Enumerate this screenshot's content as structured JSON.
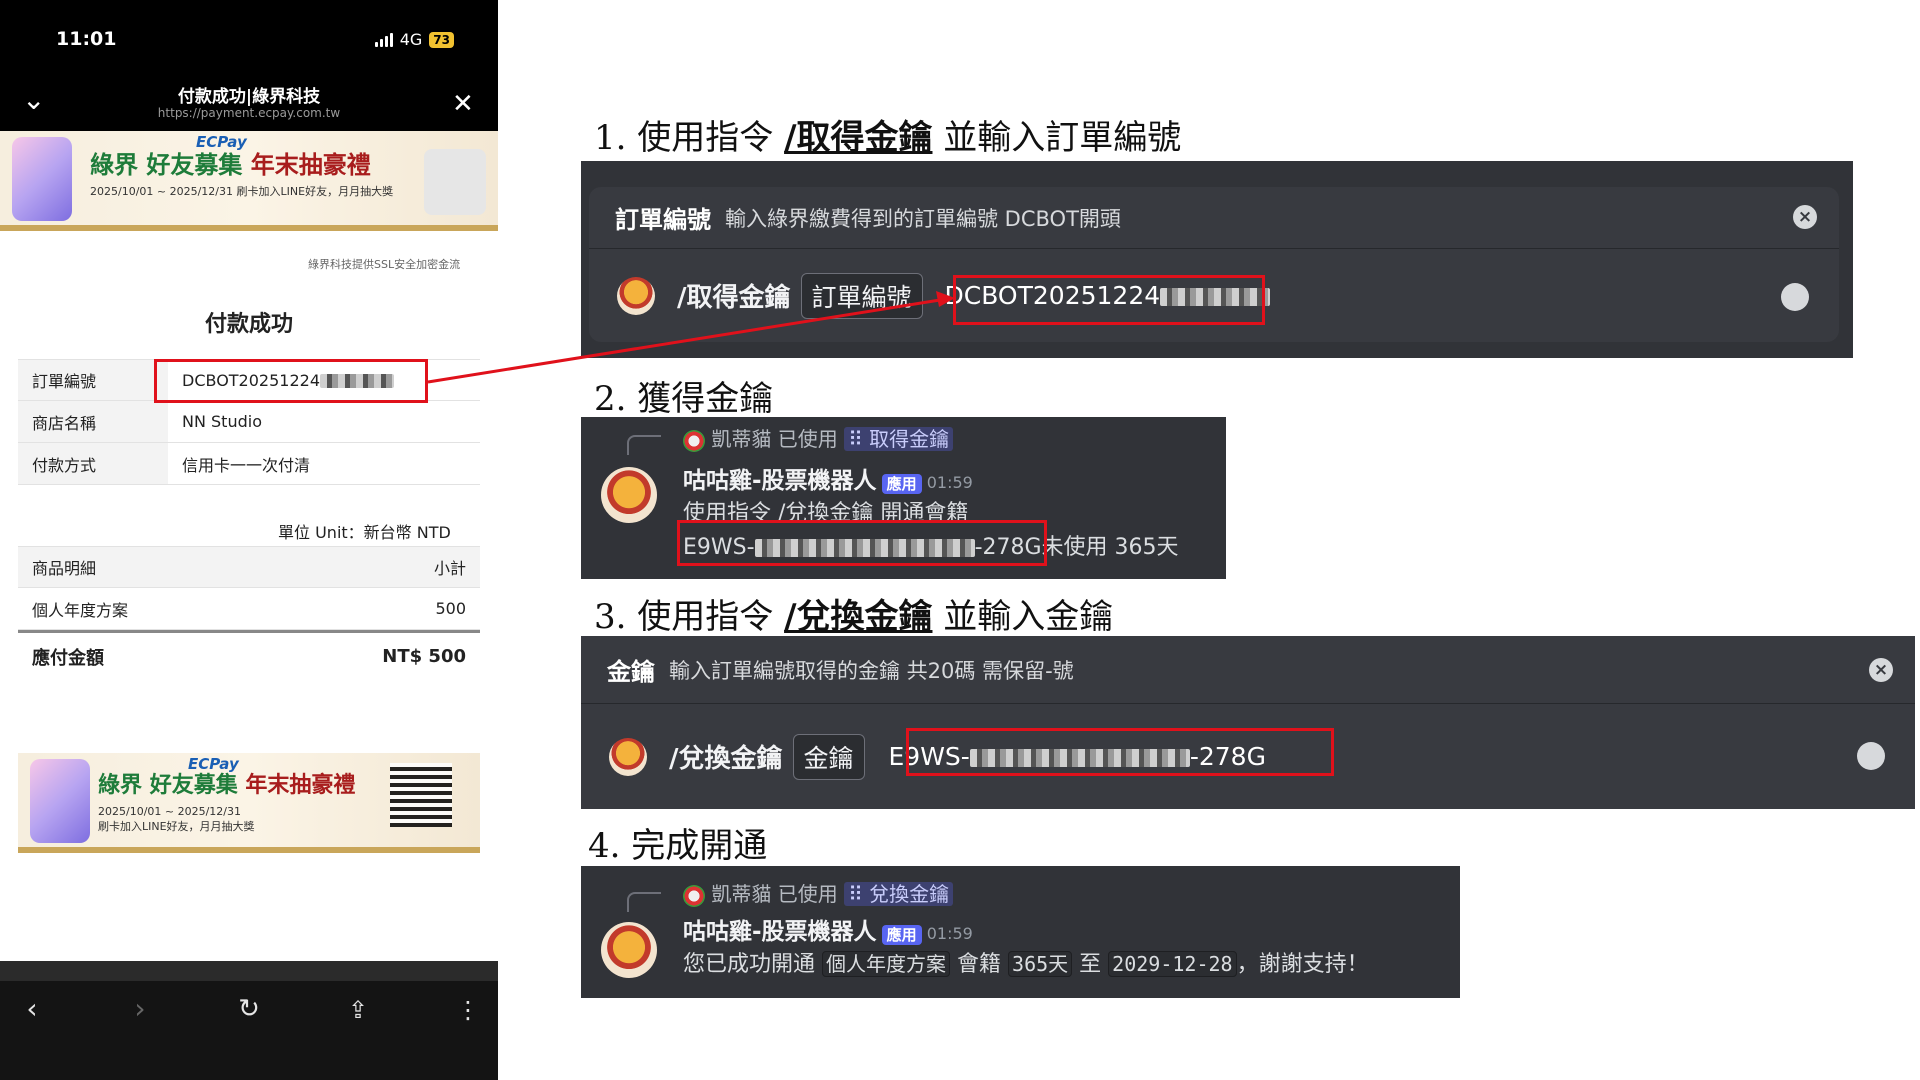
{
  "phone": {
    "status_time": "11:01",
    "network": "4G",
    "battery": "73",
    "nav_title": "付款成功|綠界科技",
    "nav_url": "https://payment.ecpay.com.tw",
    "banner": {
      "ecpay": "ECPay",
      "headline_green": "綠界",
      "headline_mid": "好友募集",
      "headline_red": "年末抽豪禮",
      "dates": "2025/10/01 ~ 2025/12/31",
      "sub": "刷卡加入LINE好友，月月抽大獎"
    },
    "ssl_note": "綠界科技提供SSL安全加密金流",
    "page_title": "付款成功",
    "order_rows": [
      {
        "label": "訂單編號",
        "value": "DCBOT20251224"
      },
      {
        "label": "商店名稱",
        "value": "NN Studio"
      },
      {
        "label": "付款方式",
        "value": "信用卡一一次付清"
      }
    ],
    "unit_note": "單位 Unit：新台幣 NTD",
    "items_header": {
      "left": "商品明細",
      "right": "小計"
    },
    "items": [
      {
        "name": "個人年度方案",
        "amount": "500"
      }
    ],
    "total": {
      "label": "應付金額",
      "value": "NT$ 500"
    }
  },
  "steps": {
    "s1": {
      "prefix": "1. 使用指令 ",
      "cmd": "/取得金鑰",
      "suffix": " 並輸入訂單編號"
    },
    "s2": {
      "text": "2. 獲得金鑰"
    },
    "s3": {
      "prefix": "3. 使用指令 ",
      "cmd": "/兌換金鑰",
      "suffix": " 並輸入金鑰"
    },
    "s4": {
      "text": "4. 完成開通"
    }
  },
  "cmd1": {
    "option_label": "訂單編號",
    "option_desc": "輸入綠界繳費得到的訂單編號 DCBOT開頭",
    "command": "/取得金鑰",
    "option_chip": "訂單編號",
    "value": "DCBOT20251224"
  },
  "msg2": {
    "user": "凱蒂貓",
    "used": "已使用",
    "mention": "取得金鑰",
    "bot": "咕咕雞-股票機器人",
    "tag": "應用",
    "time": "01:59",
    "line1": "使用指令 /兌換金鑰 開通會籍",
    "key_start": "E9WS-",
    "key_end": "-278G",
    "key_status": "未使用 365天"
  },
  "cmd3": {
    "option_label": "金鑰",
    "option_desc": "輸入訂單編號取得的金鑰 共20碼 需保留-號",
    "command": "/兌換金鑰",
    "option_chip": "金鑰",
    "key_start": "E9WS-",
    "key_end": "-278G"
  },
  "msg4": {
    "user": "凱蒂貓",
    "used": "已使用",
    "mention": "兌換金鑰",
    "bot": "咕咕雞-股票機器人",
    "tag": "應用",
    "time": "01:59",
    "t1": "您已成功開通",
    "plan": "個人年度方案",
    "t2": "會籍",
    "days": "365天",
    "t3": "至",
    "date": "2029-12-28",
    "t4": "，謝謝支持！"
  },
  "colors": {
    "discord_bg": "#313338",
    "highlight_red": "#e0111b",
    "ecpay_green": "#1e7c3a"
  }
}
